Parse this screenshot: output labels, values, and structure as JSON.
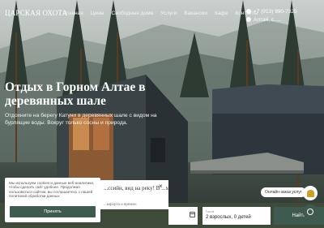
{
  "header": {
    "logo": "ЦАРСКАЯ ОХОТА",
    "nav": [
      "Главная",
      "Цены",
      "Свободные дома",
      "Услуги",
      "Вакансии",
      "Кафе",
      "Контакты"
    ],
    "phone": "+7 (913) 990-7325",
    "location": "Алтай, с. ..."
  },
  "hero": {
    "title": "Отдых в Горном Алтае в деревянных шале",
    "subtitle": "Отдохните на берегу Катуни в деревянных шале с видом на бурлящие воды. Вокруг только сосны и природа."
  },
  "cookie": {
    "text": "Мы используем cookies и данные веб-аналитики, чтобы сделать сайт удобнее. Продолжая пользоваться сайтом, вы соглашаетесь с нашей политикой обработки данных",
    "button": "Принять"
  },
  "chat_popup": {
    "title": "...ссийн, вид на реку! В ...хота»",
    "sub": "...мфорта и времен",
    "close": "×"
  },
  "booking": {
    "guests_label": "Гости",
    "guests_value": "2 взрослых, 0 детей",
    "find_button": "Найти"
  },
  "widget": {
    "online_text": "Онлайн-заказ услуг"
  },
  "colors": {
    "accent": "#3f5a4f",
    "bell": "#c9a227"
  }
}
